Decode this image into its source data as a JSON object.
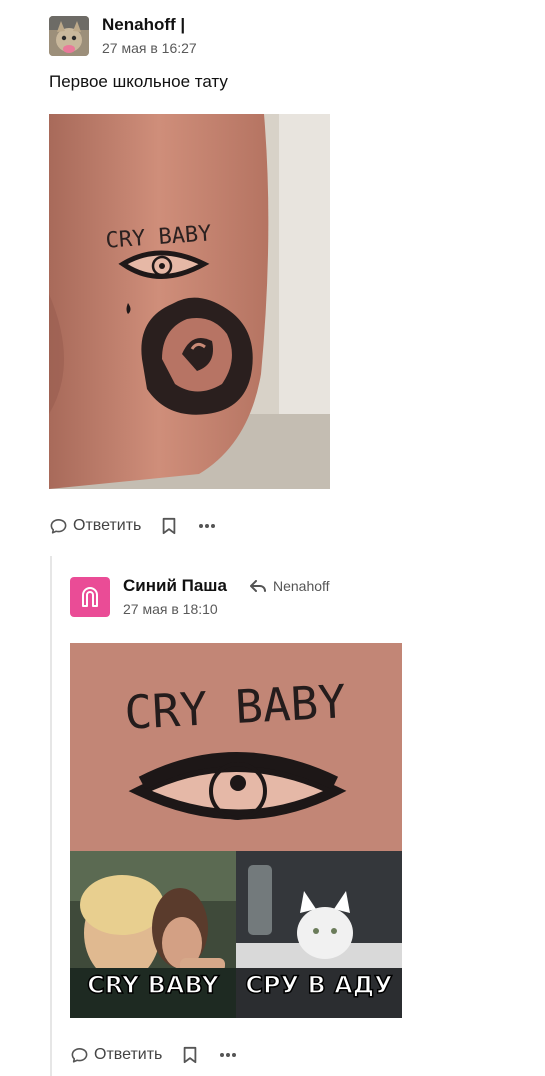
{
  "post": {
    "author": "Nenahoff |",
    "date": "27 мая в 16:27",
    "text": "Первое школьное тату",
    "image_alt": "Tattoo on arm: CRY BABY, crying eye and rose",
    "tattoo_text": "CRY BABY",
    "reply_label": "Ответить"
  },
  "reply": {
    "author": "Синий Паша",
    "reply_to": "Nenahoff",
    "date": "27 мая в 18:10",
    "image_alt": "Meme: CRY BABY tattoo closeup with woman yelling at cat",
    "tattoo_text": "CRY BABY",
    "meme_left": "CRY BABY",
    "meme_right": "СРУ В АДУ",
    "reply_label": "Ответить"
  },
  "colors": {
    "accent_pink": "#ea4c96",
    "muted_text": "#595959",
    "thread_line": "#e6e6e6"
  },
  "icons": {
    "reply": "speech-bubble-icon",
    "bookmark": "bookmark-icon",
    "more": "more-dots-icon",
    "reply_arrow": "reply-arrow-icon",
    "avatar2": "magnet-icon"
  }
}
